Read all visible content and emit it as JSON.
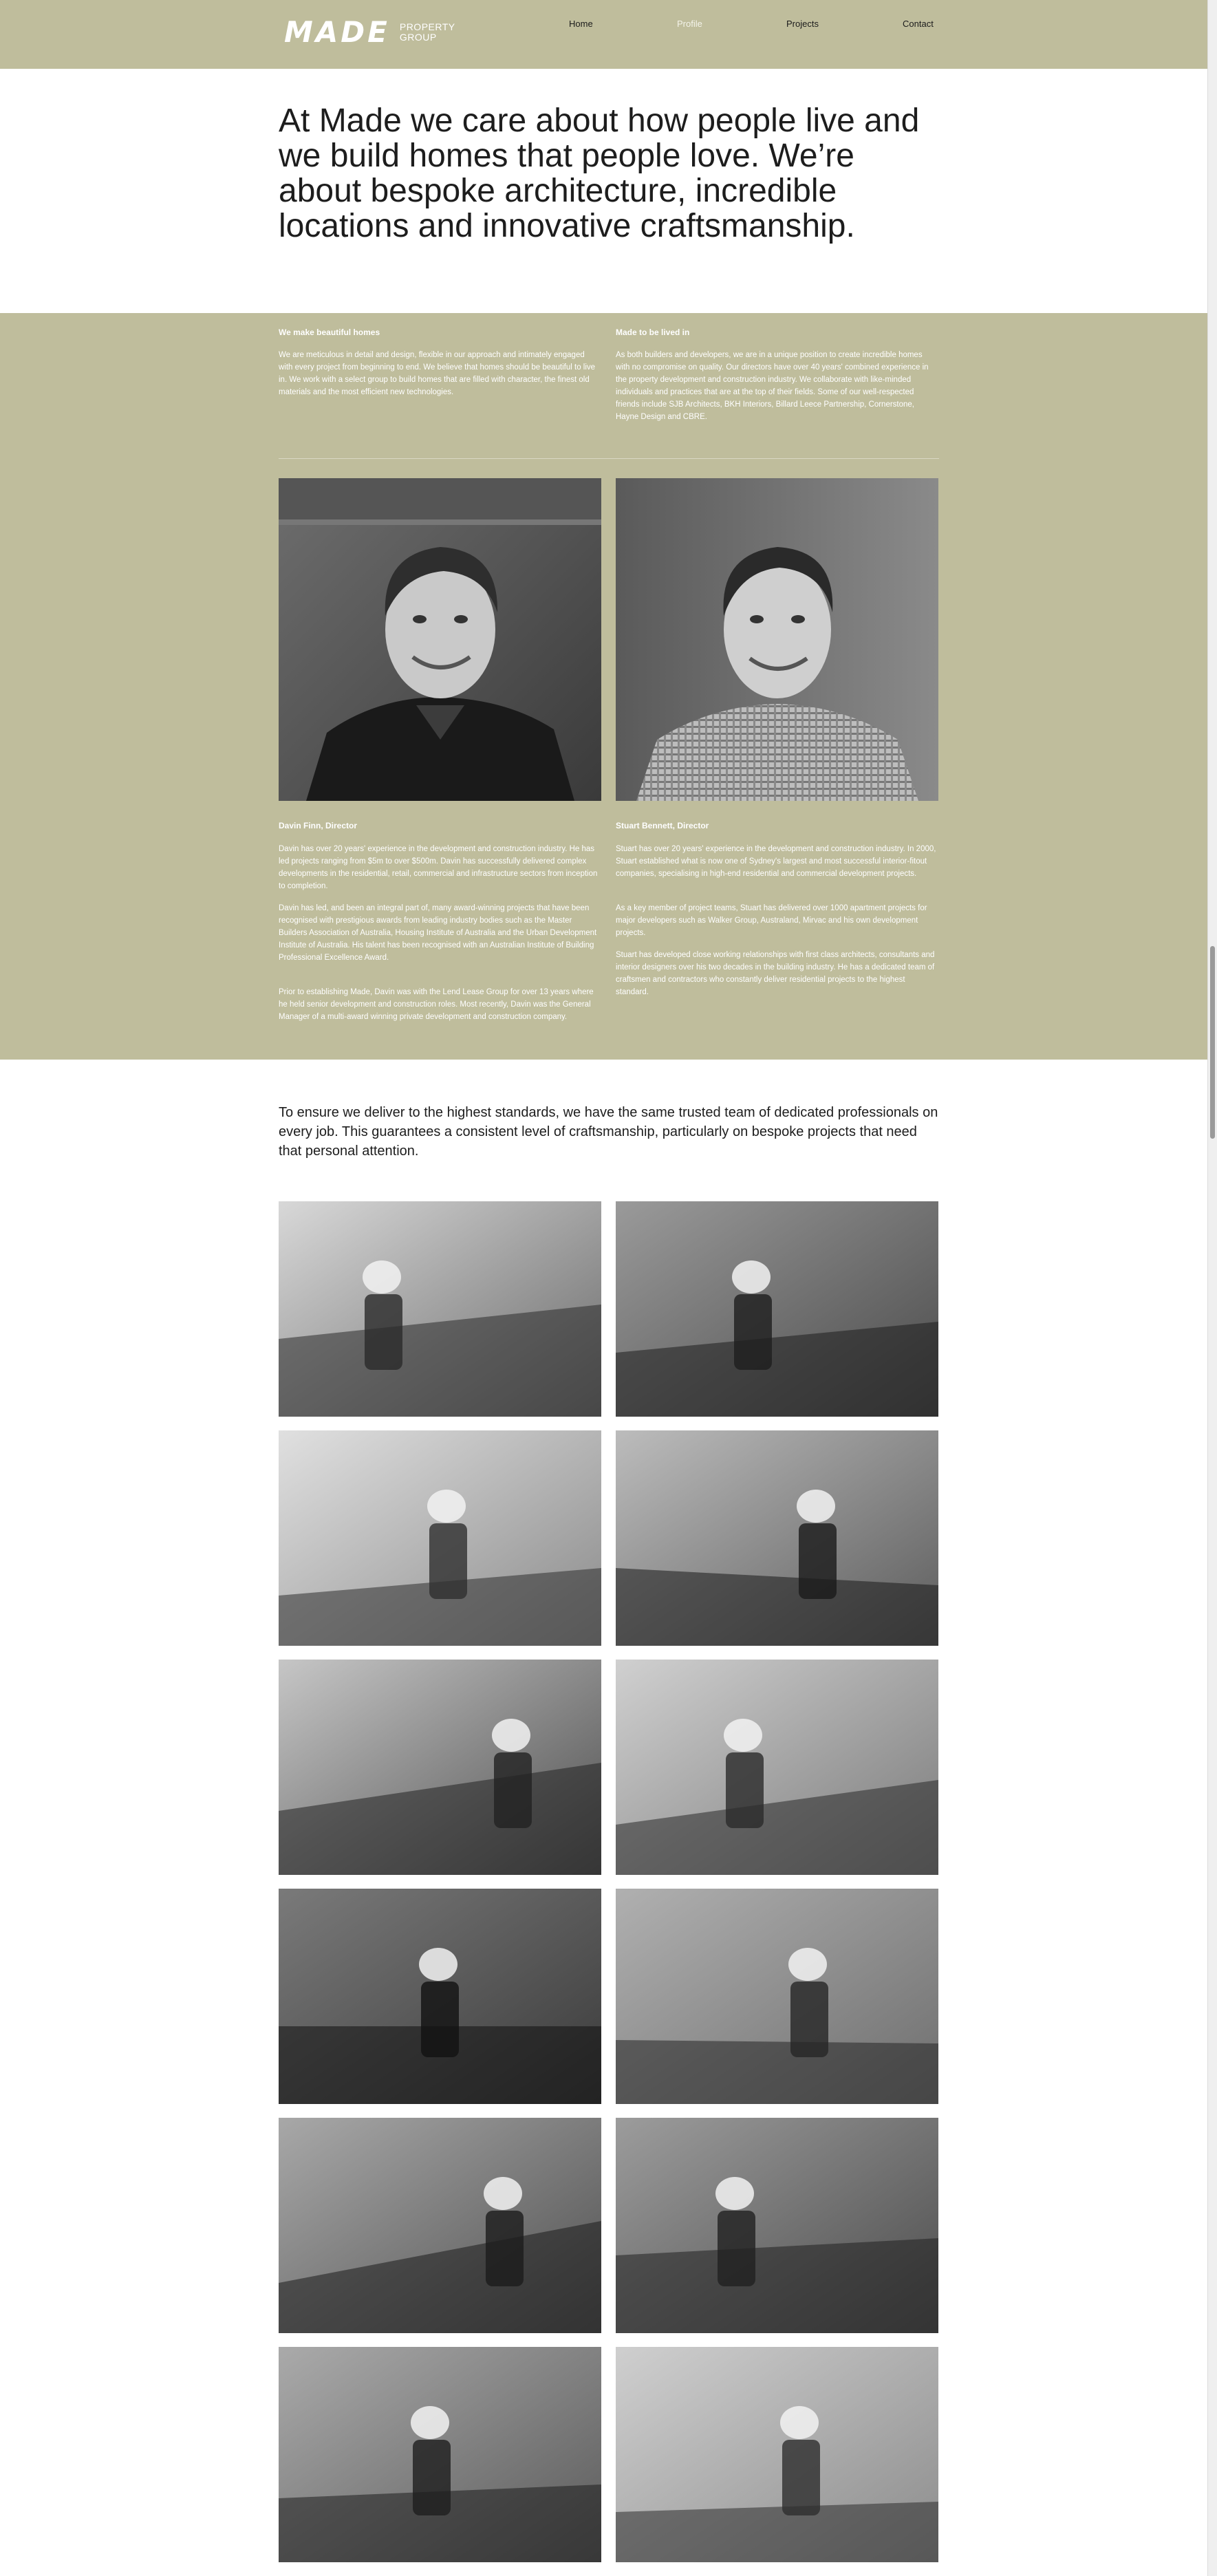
{
  "brand": {
    "logo_text": "MADE",
    "logo_sub_1": "PROPERTY",
    "logo_sub_2": "GROUP"
  },
  "nav": {
    "items": [
      "Home",
      "Profile",
      "Projects",
      "Contact"
    ],
    "active": "Profile"
  },
  "hero": {
    "text": "At Made we care about how people live and we build homes that people love. We’re about bespoke architecture, incredible locations and innovative craftsmanship."
  },
  "intro": {
    "left_title": "We make beautiful homes",
    "left_text": "We are meticulous in detail and design, flexible in our approach and intimately engaged with every project from beginning to end. We believe that homes should be beautiful to live in. We work with a select group to build homes that are filled with character, the finest old materials and the most efficient new technologies.",
    "right_title": "Made to be lived in",
    "right_text": "As both builders and developers, we are in a unique position to create incredible homes with no compromise on quality. Our directors have over 40 years' combined experience in the property development and construction industry. We collaborate with like-minded individuals and practices that are at the top of their fields. Some of our well-respected friends include SJB Architects, BKH Interiors, Billard Leece Partnership, Cornerstone, Hayne Design and CBRE."
  },
  "directors": [
    {
      "name": "Davin Finn, Director",
      "bio": [
        "Davin has over 20 years' experience in the development and construction industry. He has led projects ranging from $5m to over $500m. Davin has successfully delivered complex developments in the residential, retail, commercial and infrastructure sectors from inception to completion.",
        "Davin has led, and been an integral part of, many award-winning projects that have been recognised with prestigious awards from leading industry bodies such as the Master Builders Association of Australia, Housing Institute of Australia and the Urban Development Institute of Australia. His talent has been recognised with an Australian Institute of Building Professional Excellence Award.",
        "Prior to establishing Made, Davin was with the Lend Lease Group for over 13 years where he held senior development and construction roles. Most recently, Davin was the General Manager of a multi-award winning private development and construction company."
      ]
    },
    {
      "name": "Stuart Bennett, Director",
      "bio": [
        "Stuart has over 20 years' experience in the development and construction industry. In 2000, Stuart established what is now one of Sydney's largest and most successful interior-fitout companies, specialising in high-end residential and commercial development projects.",
        "As a key member of project teams, Stuart has delivered over 1000 apartment projects for major developers such as Walker Group, Australand, Mirvac and his own development projects.",
        "Stuart has developed close working relationships with first class architects, consultants and interior designers over his two decades in the building industry. He has a dedicated team of craftsmen and contractors who constantly deliver residential projects to the highest standard."
      ]
    }
  ],
  "statement": {
    "text": "To ensure we deliver to the highest standards, we have the same trusted team of dedicated professionals on every job. This guarantees a consistent level of craftsmanship, particularly on bespoke projects that need that personal attention."
  },
  "colors": {
    "olive": "#bfbd9c",
    "text_dark": "#1d1d1d",
    "white": "#ffffff"
  }
}
